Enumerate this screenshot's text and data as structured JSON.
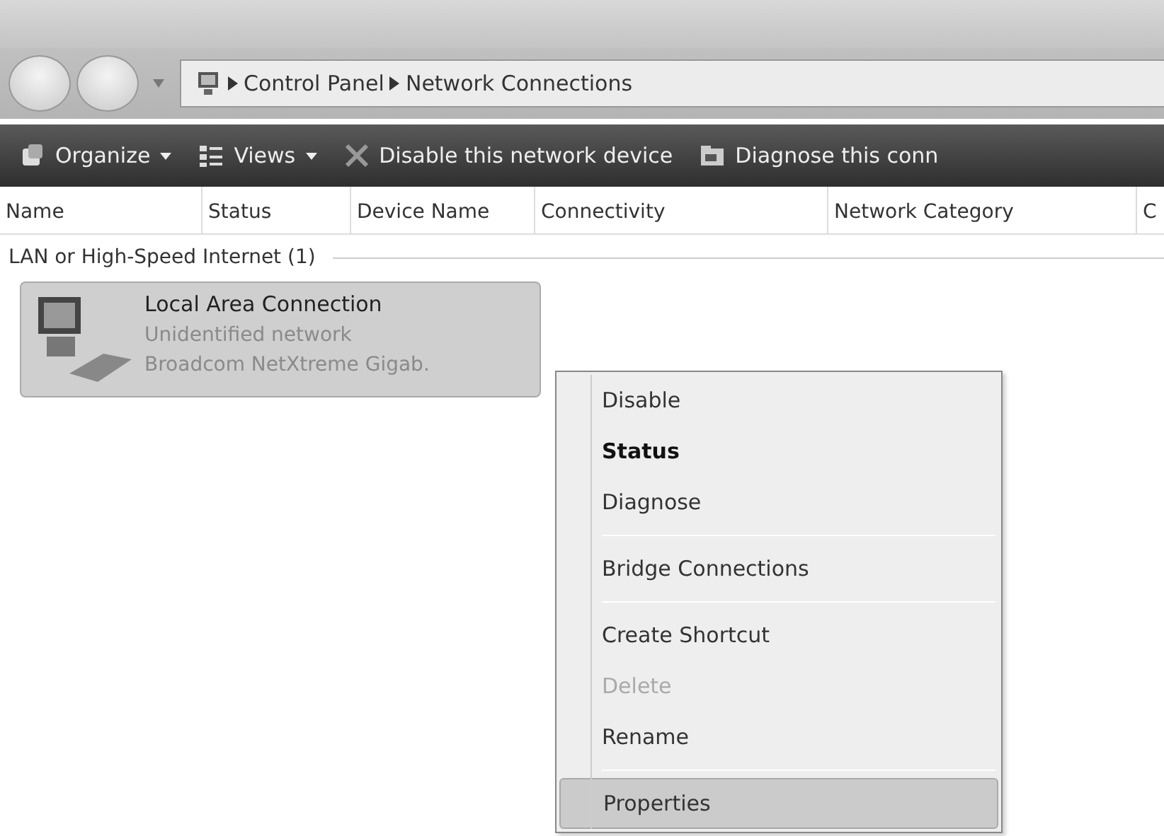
{
  "breadcrumb": [
    {
      "label": "Control Panel"
    },
    {
      "label": "Network Connections"
    }
  ],
  "toolbar": [
    {
      "label": "Organize",
      "kind": "organize",
      "dropdown": true
    },
    {
      "label": "Views",
      "kind": "views",
      "dropdown": true
    },
    {
      "label": "Disable this network device",
      "kind": "disable",
      "dropdown": false
    },
    {
      "label": "Diagnose this conn",
      "kind": "diagnose",
      "dropdown": false
    }
  ],
  "columns": [
    "Name",
    "Status",
    "Device Name",
    "Connectivity",
    "Network Category",
    "C"
  ],
  "group": {
    "title": "LAN or High-Speed Internet (1)"
  },
  "items": [
    {
      "name": "Local Area Connection",
      "status": "Unidentified network",
      "device": "Broadcom NetXtreme Gigab.",
      "selected": true
    }
  ],
  "context_menu": [
    {
      "kind": "item",
      "label": "Disable",
      "default": false,
      "disabled": false,
      "selected": false
    },
    {
      "kind": "item",
      "label": "Status",
      "default": true,
      "disabled": false,
      "selected": false
    },
    {
      "kind": "item",
      "label": "Diagnose",
      "default": false,
      "disabled": false,
      "selected": false
    },
    {
      "kind": "separator"
    },
    {
      "kind": "item",
      "label": "Bridge Connections",
      "default": false,
      "disabled": false,
      "selected": false
    },
    {
      "kind": "separator"
    },
    {
      "kind": "item",
      "label": "Create Shortcut",
      "default": false,
      "disabled": false,
      "selected": false
    },
    {
      "kind": "item",
      "label": "Delete",
      "default": false,
      "disabled": true,
      "selected": false
    },
    {
      "kind": "item",
      "label": "Rename",
      "default": false,
      "disabled": false,
      "selected": false
    },
    {
      "kind": "separator"
    },
    {
      "kind": "item",
      "label": "Properties",
      "default": false,
      "disabled": false,
      "selected": true
    }
  ]
}
